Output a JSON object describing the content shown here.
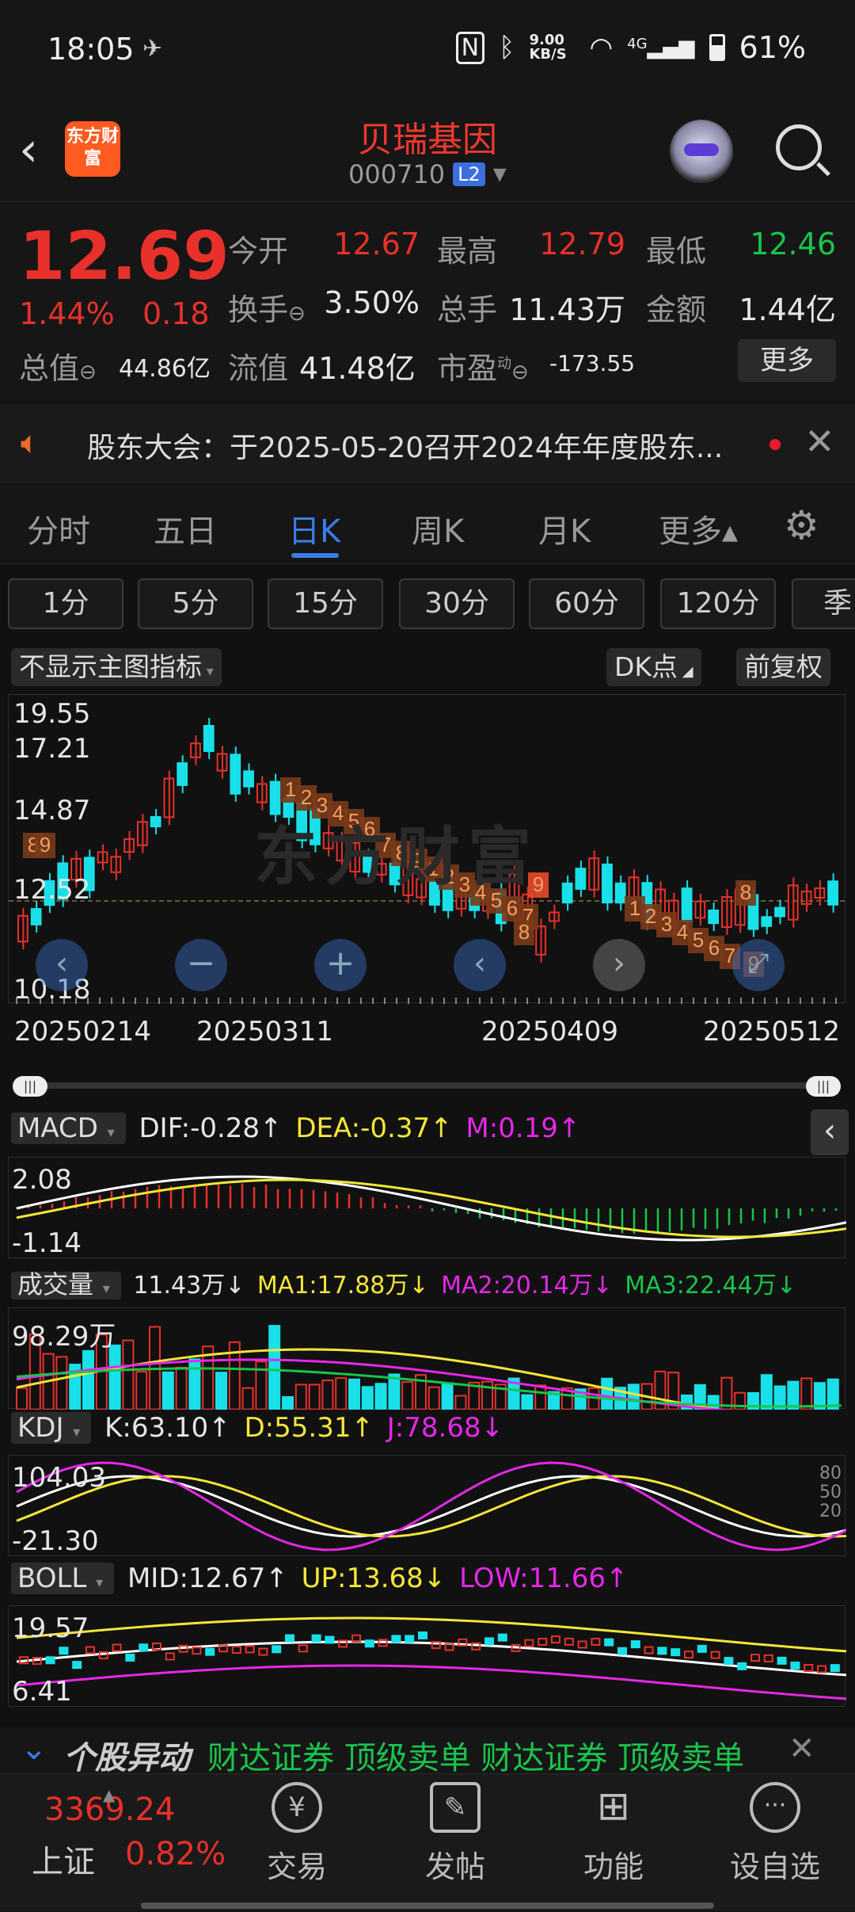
{
  "status_bar": {
    "time": "18:05",
    "network_speed": "9.00 KB/S",
    "signal": "4G",
    "battery": "61%"
  },
  "header": {
    "logo_text": "东方财富",
    "stock_name": "贝瑞基因",
    "stock_code": "000710",
    "level_badge": "L2"
  },
  "quote": {
    "price": "12.69",
    "change_pct": "1.44%",
    "change": "0.18",
    "open_label": "今开",
    "open": "12.67",
    "high_label": "最高",
    "high": "12.79",
    "low_label": "最低",
    "low": "12.46",
    "turnover_label": "换手",
    "turnover": "3.50%",
    "volume_label": "总手",
    "volume": "11.43万",
    "amount_label": "金额",
    "amount": "1.44亿",
    "mktcap_label": "总值",
    "mktcap": "44.86亿",
    "float_label": "流值",
    "float_cap": "41.48亿",
    "pe_label": "市盈",
    "pe_superscript": "动",
    "pe": "-173.55",
    "more_button": "更多"
  },
  "notice": {
    "text": "股东大会：于2025-05-20召开2024年年度股东..."
  },
  "period_tabs": [
    {
      "label": "分时"
    },
    {
      "label": "五日"
    },
    {
      "label": "日K",
      "active": true
    },
    {
      "label": "周K"
    },
    {
      "label": "月K"
    },
    {
      "label": "更多▴"
    }
  ],
  "minute_tabs": [
    "1分",
    "5分",
    "15分",
    "30分",
    "60分",
    "120分",
    "季"
  ],
  "chart_toolbar": {
    "indicator_select": "不显示主图指标",
    "dk_button": "DK点",
    "adjust_button": "前复权"
  },
  "watermark": "东方财富",
  "main_chart": {
    "y_labels": [
      "19.55",
      "17.21",
      "14.87",
      "12.52",
      "10.18"
    ],
    "x_labels": [
      "20250214",
      "20250311",
      "20250409",
      "20250512"
    ],
    "td_markers": [
      "8",
      "9",
      "1",
      "2",
      "3",
      "4",
      "5",
      "6",
      "7",
      "8",
      "9",
      "1",
      "2",
      "3",
      "4",
      "5",
      "6",
      "7",
      "9",
      "8",
      "1",
      "2",
      "3",
      "4",
      "5",
      "6",
      "7",
      "8",
      "9"
    ]
  },
  "macd": {
    "name": "MACD",
    "dif": "DIF:-0.28↑",
    "dea": "DEA:-0.37↑",
    "m": "M:0.19↑",
    "y_top": "2.08",
    "y_bottom": "-1.14"
  },
  "volume": {
    "name": "成交量",
    "value": "11.43万↓",
    "ma1": "MA1:17.88万↓",
    "ma2": "MA2:20.14万↓",
    "ma3": "MA3:22.44万↓",
    "y_top": "98.29万"
  },
  "kdj": {
    "name": "KDJ",
    "k": "K:63.10↑",
    "d": "D:55.31↑",
    "j": "J:78.68↓",
    "y_top": "104.03",
    "y_bottom": "-21.30",
    "ref_high": "80",
    "ref_mid": "50",
    "ref_low": "20"
  },
  "boll": {
    "name": "BOLL",
    "mid": "MID:12.67↑",
    "up": "UP:13.68↓",
    "low": "LOW:11.66↑",
    "y_top": "19.57",
    "y_bottom": "6.41"
  },
  "news_ticker": {
    "label": "个股异动",
    "text": "财达证券 顶级卖单 财达证券 顶级卖单"
  },
  "bottom_nav": {
    "index_price": "3369.24",
    "index_name": "上证",
    "index_change": "0.82%",
    "items": [
      {
        "label": "交易"
      },
      {
        "label": "发帖"
      },
      {
        "label": "功能"
      },
      {
        "label": "设自选"
      }
    ]
  },
  "colors": {
    "up": "#e8312b",
    "down": "#19e0e8",
    "accent": "#3b7de8",
    "ma_yellow": "#f5e63a",
    "ma_magenta": "#e528e8",
    "ma_green": "#19c44b"
  }
}
